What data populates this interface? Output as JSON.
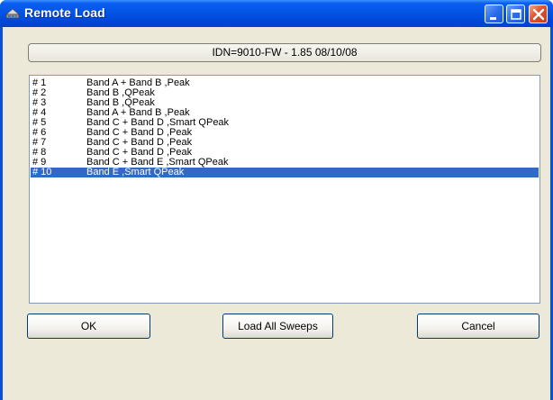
{
  "window": {
    "title": "Remote Load",
    "title_icon": "remote-load-icon",
    "controls": {
      "minimize_icon": "minimize-icon",
      "maximize_icon": "maximize-icon",
      "close_icon": "close-icon"
    }
  },
  "idn": "IDN=9010-FW - 1.85 08/10/08",
  "sweeps": [
    {
      "num": "# 1",
      "desc": "Band A + Band B ,Peak",
      "selected": false
    },
    {
      "num": "# 2",
      "desc": "Band B ,QPeak",
      "selected": false
    },
    {
      "num": "# 3",
      "desc": "Band B ,QPeak",
      "selected": false
    },
    {
      "num": "# 4",
      "desc": "Band A + Band B ,Peak",
      "selected": false
    },
    {
      "num": "# 5",
      "desc": "Band C + Band D ,Smart QPeak",
      "selected": false
    },
    {
      "num": "# 6",
      "desc": "Band C + Band D ,Peak",
      "selected": false
    },
    {
      "num": "# 7",
      "desc": "Band C + Band D ,Peak",
      "selected": false
    },
    {
      "num": "# 8",
      "desc": "Band C + Band D ,Peak",
      "selected": false
    },
    {
      "num": "# 9",
      "desc": "Band C + Band E ,Smart QPeak",
      "selected": false
    },
    {
      "num": "# 10",
      "desc": "Band E ,Smart QPeak",
      "selected": true
    }
  ],
  "buttons": {
    "ok": "OK",
    "load_all": "Load All Sweeps",
    "cancel": "Cancel"
  },
  "colors": {
    "titlebar": "#0355e3",
    "client_bg": "#ece9d8",
    "selection": "#316ac5",
    "button_border": "#003c74"
  }
}
